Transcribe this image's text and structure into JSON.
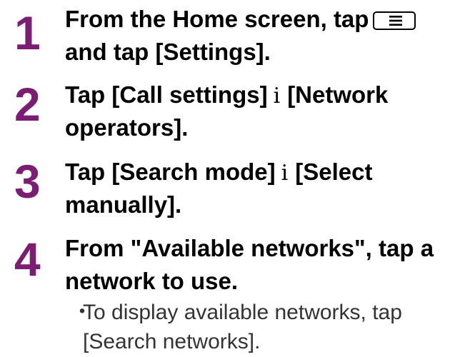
{
  "steps": [
    {
      "number": "1",
      "line1_prefix": "From the Home screen, tap",
      "line2": "and tap [Settings]."
    },
    {
      "number": "2",
      "line1_a": "Tap [Call settings]",
      "arrow": "i",
      "line1_b": "[Network",
      "line2": "operators]."
    },
    {
      "number": "3",
      "line1_a": "Tap [Search mode]",
      "arrow": "i",
      "line1_b": "[Select",
      "line2": "manually]."
    },
    {
      "number": "4",
      "line1": "From \"Available networks\", tap a",
      "line2": "network to use.",
      "note_bullet": "・",
      "note_line1": "To display available networks, tap",
      "note_line2": "[Search networks]."
    }
  ],
  "icons": {
    "menu_key": "menu-key-icon"
  }
}
